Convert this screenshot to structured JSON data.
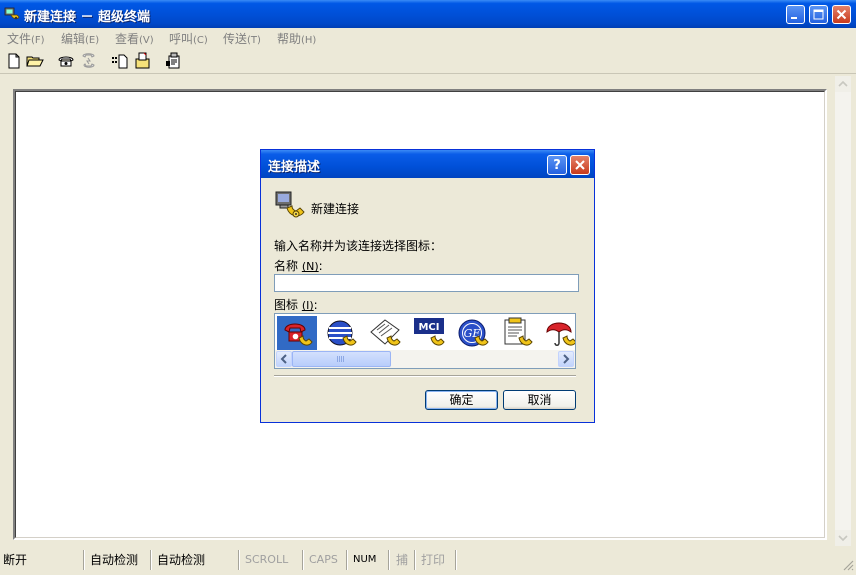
{
  "window": {
    "title": "新建连接 － 超级终端",
    "controls": [
      "minimize",
      "maximize",
      "close"
    ]
  },
  "menu": [
    {
      "label": "文件",
      "accel": "(F)"
    },
    {
      "label": "编辑",
      "accel": "(E)"
    },
    {
      "label": "查看",
      "accel": "(V)"
    },
    {
      "label": "呼叫",
      "accel": "(C)"
    },
    {
      "label": "传送",
      "accel": "(T)"
    },
    {
      "label": "帮助",
      "accel": "(H)"
    }
  ],
  "toolbar": {
    "icons": [
      "new-file-icon",
      "open-folder-icon",
      "dial-icon",
      "disconnect-icon",
      "send-icon",
      "receive-icon",
      "properties-icon"
    ]
  },
  "dialog": {
    "title": "连接描述",
    "help_label": "?",
    "connection_name": "新建连接",
    "prompt": "输入名称并为该连接选择图标：",
    "name_label": "名称",
    "name_accel": "(N)",
    "name_value": "",
    "icon_label": "图标",
    "icon_accel": "(I)",
    "icons": [
      {
        "name": "red-phone-icon",
        "selected": true
      },
      {
        "name": "globe-icon",
        "selected": false
      },
      {
        "name": "newspaper-icon",
        "selected": false
      },
      {
        "name": "mci-icon",
        "text": "MCI",
        "selected": false
      },
      {
        "name": "ge-icon",
        "text": "GE",
        "selected": false
      },
      {
        "name": "document-icon",
        "selected": false
      },
      {
        "name": "umbrella-icon",
        "selected": false
      }
    ],
    "ok_label": "确定",
    "cancel_label": "取消"
  },
  "status": {
    "connection": "断开",
    "detect1": "自动检测",
    "detect2": "自动检测",
    "scroll": "SCROLL",
    "caps": "CAPS",
    "num": "NUM",
    "capture": "捕",
    "print": "打印"
  },
  "colors": {
    "titlebar": "#0054e3",
    "dialog_border": "#0831d9",
    "selection": "#316ac5",
    "face": "#ece9d8"
  }
}
